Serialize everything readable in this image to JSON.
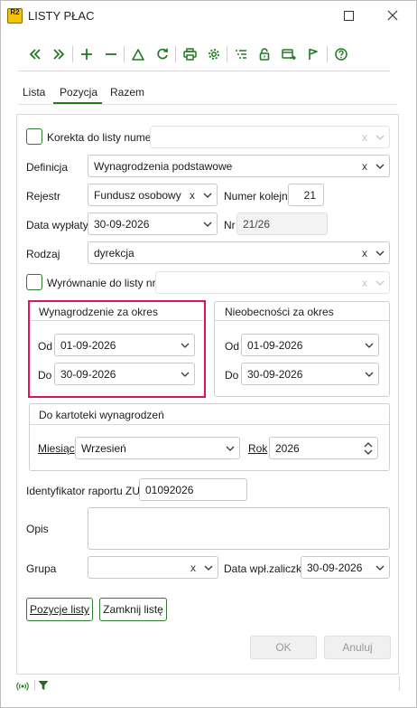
{
  "window": {
    "logo": "R2",
    "title": "LISTY PŁAC"
  },
  "toolbar": {
    "icons": [
      "first-icon",
      "last-icon",
      "add-icon",
      "remove-icon",
      "warning-icon",
      "refresh-icon",
      "print-icon",
      "settings-icon",
      "list-icon",
      "unlock-icon",
      "transfer-icon",
      "flag-icon",
      "help-icon"
    ]
  },
  "tabs": [
    {
      "label": "Lista"
    },
    {
      "label": "Pozycja",
      "active": true
    },
    {
      "label": "Razem"
    }
  ],
  "form": {
    "korekta": {
      "label": "Korekta do listy numer",
      "value": ""
    },
    "definicja": {
      "label": "Definicja",
      "value": "Wynagrodzenia podstawowe"
    },
    "rejestr": {
      "label": "Rejestr",
      "value": "Fundusz osobowy"
    },
    "numer_kolejny": {
      "label": "Numer kolejny",
      "value": "21"
    },
    "data_wyplaty": {
      "label": "Data wypłaty",
      "value": "30-09-2026"
    },
    "nr": {
      "label": "Nr",
      "value": "21/26"
    },
    "rodzaj": {
      "label": "Rodzaj",
      "value": "dyrekcja"
    },
    "wyrownanie": {
      "label": "Wyrównanie do listy nr",
      "value": ""
    },
    "wynagrodzenie_okres": {
      "title": "Wynagrodzenie za okres",
      "od_label": "Od",
      "od_value": "01-09-2026",
      "do_label": "Do",
      "do_value": "30-09-2026"
    },
    "nieobecnosci_okres": {
      "title": "Nieobecności za okres",
      "od_label": "Od",
      "od_value": "01-09-2026",
      "do_label": "Do",
      "do_value": "30-09-2026"
    },
    "kartoteka": {
      "title": "Do kartoteki wynagrodzeń",
      "miesiac_label": "Miesiąc",
      "miesiac_value": "Wrzesień",
      "rok_label": "Rok",
      "rok_value": "2026"
    },
    "identyfikator": {
      "label": "Identyfikator raportu ZUS",
      "value": "01092026"
    },
    "opis": {
      "label": "Opis",
      "value": ""
    },
    "grupa": {
      "label": "Grupa",
      "value": ""
    },
    "data_wpl": {
      "label": "Data wpł.zaliczki",
      "value": "30-09-2026"
    }
  },
  "buttons": {
    "pozycje": "Pozycje listy",
    "zamknij": "Zamknij listę",
    "ok": "OK",
    "anuluj": "Anuluj"
  },
  "clear_symbol": "x",
  "colors": {
    "accent": "#1f7a1f",
    "highlight": "#e0115f"
  }
}
